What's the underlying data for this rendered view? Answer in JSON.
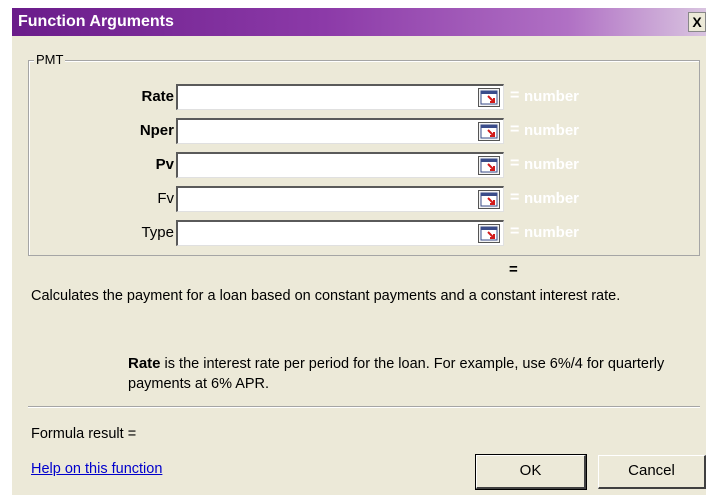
{
  "window": {
    "title": "Function Arguments",
    "close_label": "X"
  },
  "function_group": {
    "name": "PMT",
    "arguments": [
      {
        "label": "Rate",
        "value": "",
        "equals": "=",
        "result_type": "number",
        "bold": true
      },
      {
        "label": "Nper",
        "value": "",
        "equals": "=",
        "result_type": "number",
        "bold": true
      },
      {
        "label": "Pv",
        "value": "",
        "equals": "=",
        "result_type": "number",
        "bold": true
      },
      {
        "label": "Fv",
        "value": "",
        "equals": "=",
        "result_type": "number",
        "bold": false
      },
      {
        "label": "Type",
        "value": "",
        "equals": "=",
        "result_type": "number",
        "bold": false
      }
    ]
  },
  "result_equals": "=",
  "description": "Calculates the payment for a loan based on constant payments and a constant interest rate.",
  "argument_help": {
    "name": "Rate",
    "text": "is the interest rate per period for the loan. For example, use 6%/4 for quarterly payments at 6% APR."
  },
  "formula_result_label": "Formula result =",
  "help_link": "Help on this function",
  "buttons": {
    "ok": "OK",
    "cancel": "Cancel"
  },
  "colors": {
    "title_bar": "#6a1c8a",
    "dialog_bg": "#ece9d8",
    "link": "#0000cc"
  }
}
